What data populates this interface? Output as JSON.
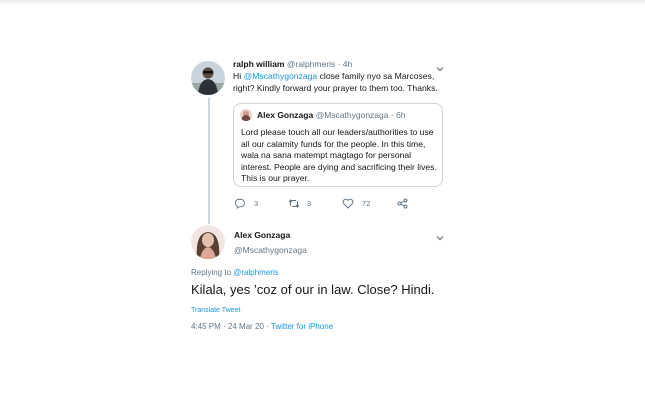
{
  "tweet": {
    "author_name": "ralph william",
    "author_handle": "@ralphmeris",
    "separator": "·",
    "time": "4h",
    "text_prefix": "Hi ",
    "text_mention": "@Mscathygonzaga",
    "text_line1_rest": " close family nyo sa Marcoses,",
    "text_line2": "right? Kindly forward your prayer to them too. Thanks.",
    "quoted": {
      "author_name": "Alex Gonzaga",
      "author_handle": "@Mscathygonzaga",
      "separator": "·",
      "time": "6h",
      "lines": [
        "Lord please touch all our leaders/authorities to use",
        "all our calamity funds for the people. In this time,",
        "wala na sana matempt magtago for personal",
        "interest. People are dying and sacrificing their lives.",
        "This is our prayer."
      ]
    },
    "actions": {
      "reply_count": "3",
      "retweet_count": "3",
      "like_count": "72"
    }
  },
  "reply": {
    "author_name": "Alex Gonzaga",
    "author_handle": "@Mscathygonzaga",
    "replying_to_label": "Replying to ",
    "replying_to_handle": "@ralphmeris",
    "text": "Kilala, yes ’coz of our in law. Close? Hindi.",
    "translate_label": "Translate Tweet",
    "timestamp": "4:45 PM · 24 Mar 20 · ",
    "source": "Twitter for iPhone"
  },
  "colors": {
    "link": "#1b95e0",
    "muted": "#657786",
    "border": "#ccd6dd",
    "text": "#14171a"
  },
  "icons": {
    "reply": "comment-icon",
    "retweet": "retweet-icon",
    "like": "heart-icon",
    "share": "share-icon",
    "more": "chevron-down-icon"
  }
}
